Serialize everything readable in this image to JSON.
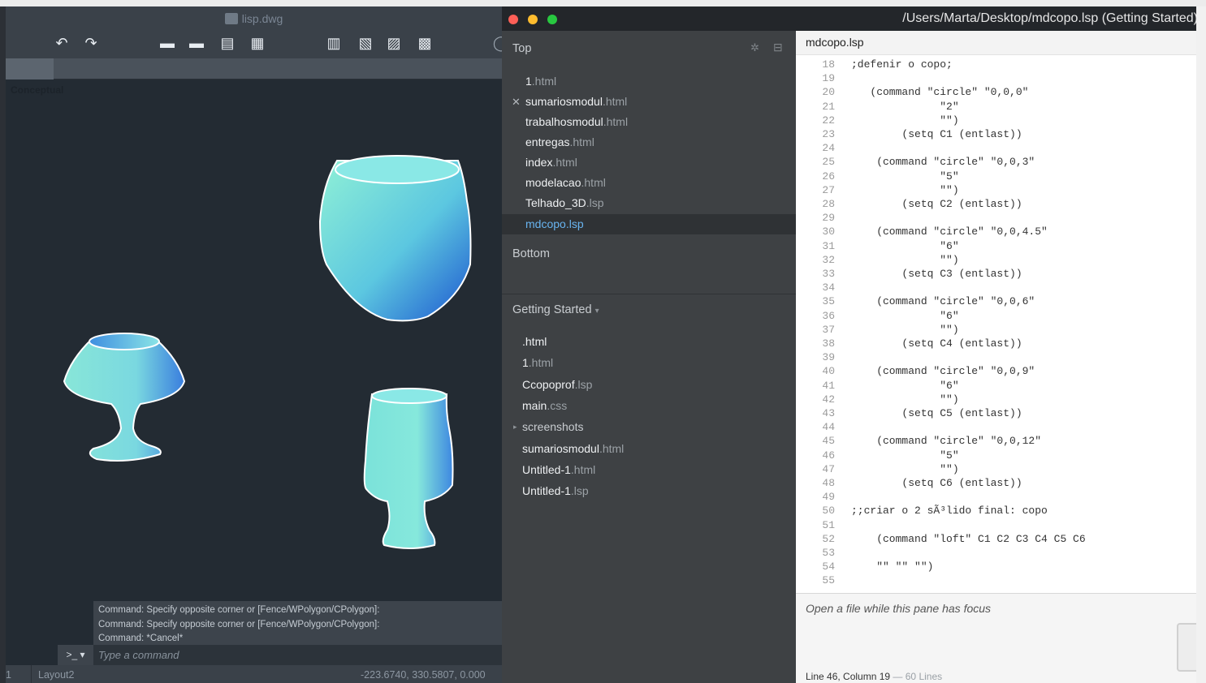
{
  "cad": {
    "title": "lisp.dwg",
    "view_label": "Conceptual",
    "command_history": [
      "Command: Specify opposite corner or [Fence/WPolygon/CPolygon]:",
      "Command: Specify opposite corner or [Fence/WPolygon/CPolygon]:",
      "Command: *Cancel*"
    ],
    "command_prompt": ">_ ▾",
    "command_placeholder": "Type a command",
    "status_num": "1",
    "layout_tab": "Layout2",
    "coordinates": "-223.6740, 330.5807, 0.000"
  },
  "editor": {
    "window_title": "/Users/Marta/Desktop/mdcopo.lsp (Getting Started)",
    "sidebar": {
      "top_label": "Top",
      "bottom_label": "Bottom",
      "project_label": "Getting Started",
      "open_files": [
        {
          "name": "1",
          "ext": ".html"
        },
        {
          "name": "sumariosmodul",
          "ext": ".html"
        },
        {
          "name": "trabalhosmodul",
          "ext": ".html"
        },
        {
          "name": "entregas",
          "ext": ".html"
        },
        {
          "name": "index",
          "ext": ".html"
        },
        {
          "name": "modelacao",
          "ext": ".html"
        },
        {
          "name": "Telhado_3D",
          "ext": ".lsp"
        },
        {
          "name": "mdcopo",
          "ext": ".lsp"
        }
      ],
      "project_files": [
        {
          "name": ".html",
          "ext": ""
        },
        {
          "name": "1",
          "ext": ".html"
        },
        {
          "name": "Ccopoprof",
          "ext": ".lsp"
        },
        {
          "name": "main",
          "ext": ".css"
        },
        {
          "name": "screenshots",
          "ext": ""
        },
        {
          "name": "sumariosmodul",
          "ext": ".html"
        },
        {
          "name": "Untitled-1",
          "ext": ".html"
        },
        {
          "name": "Untitled-1",
          "ext": ".lsp"
        }
      ]
    },
    "tab_title": "mdcopo.lsp",
    "code_lines": [
      {
        "n": "18",
        "t": ";defenir o copo;"
      },
      {
        "n": "19",
        "t": ""
      },
      {
        "n": "20",
        "t": "   (command \"circle\" \"0,0,0\""
      },
      {
        "n": "21",
        "t": "              \"2\""
      },
      {
        "n": "22",
        "t": "              \"\")"
      },
      {
        "n": "23",
        "t": "        (setq C1 (entlast))"
      },
      {
        "n": "24",
        "t": ""
      },
      {
        "n": "25",
        "t": "    (command \"circle\" \"0,0,3\""
      },
      {
        "n": "26",
        "t": "              \"5\""
      },
      {
        "n": "27",
        "t": "              \"\")"
      },
      {
        "n": "28",
        "t": "        (setq C2 (entlast))"
      },
      {
        "n": "29",
        "t": ""
      },
      {
        "n": "30",
        "t": "    (command \"circle\" \"0,0,4.5\""
      },
      {
        "n": "31",
        "t": "              \"6\""
      },
      {
        "n": "32",
        "t": "              \"\")"
      },
      {
        "n": "33",
        "t": "        (setq C3 (entlast))"
      },
      {
        "n": "34",
        "t": ""
      },
      {
        "n": "35",
        "t": "    (command \"circle\" \"0,0,6\""
      },
      {
        "n": "36",
        "t": "              \"6\""
      },
      {
        "n": "37",
        "t": "              \"\")"
      },
      {
        "n": "38",
        "t": "        (setq C4 (entlast))"
      },
      {
        "n": "39",
        "t": ""
      },
      {
        "n": "40",
        "t": "    (command \"circle\" \"0,0,9\""
      },
      {
        "n": "41",
        "t": "              \"6\""
      },
      {
        "n": "42",
        "t": "              \"\")"
      },
      {
        "n": "43",
        "t": "        (setq C5 (entlast))"
      },
      {
        "n": "44",
        "t": ""
      },
      {
        "n": "45",
        "t": "    (command \"circle\" \"0,0,12\""
      },
      {
        "n": "46",
        "t": "              \"5\""
      },
      {
        "n": "47",
        "t": "              \"\")"
      },
      {
        "n": "48",
        "t": "        (setq C6 (entlast))"
      },
      {
        "n": "49",
        "t": ""
      },
      {
        "n": "50",
        "t": ";;criar o 2 sÃ³lido final: copo"
      },
      {
        "n": "51",
        "t": ""
      },
      {
        "n": "52",
        "t": "    (command \"loft\" C1 C2 C3 C4 C5 C6"
      },
      {
        "n": "53",
        "t": ""
      },
      {
        "n": "54",
        "t": "    \"\" \"\" \"\")"
      },
      {
        "n": "55",
        "t": ""
      }
    ],
    "pane_message": "Open a file while this pane has focus",
    "status_position": "Line 46, Column 19",
    "status_lines": "— 60 Lines"
  }
}
